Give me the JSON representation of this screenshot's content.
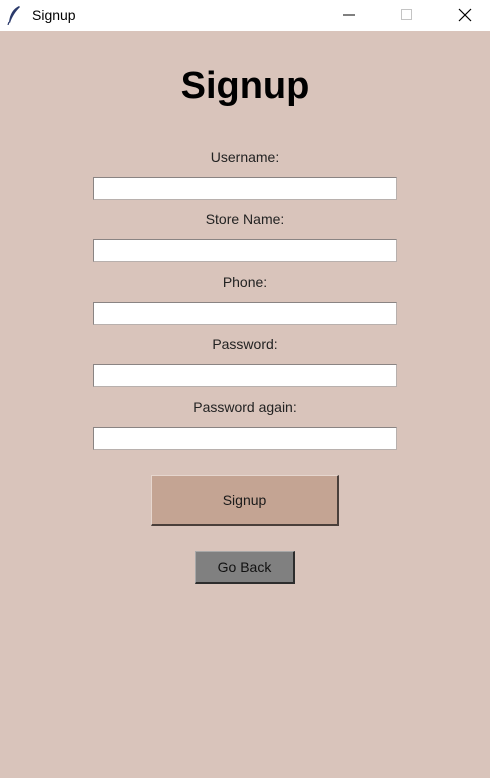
{
  "window": {
    "title": "Signup",
    "icon": "feather-icon",
    "controls": {
      "minimize": "minimize-icon",
      "maximize": "maximize-icon",
      "close": "close-icon"
    }
  },
  "form": {
    "heading": "Signup",
    "fields": [
      {
        "label": "Username:",
        "value": ""
      },
      {
        "label": "Store Name:",
        "value": ""
      },
      {
        "label": "Phone:",
        "value": ""
      },
      {
        "label": "Password:",
        "value": ""
      },
      {
        "label": "Password again:",
        "value": ""
      }
    ],
    "signup_label": "Signup",
    "back_label": "Go Back"
  },
  "colors": {
    "background": "#d9c4bb",
    "signup_button": "#c4a493",
    "back_button": "#808080"
  }
}
